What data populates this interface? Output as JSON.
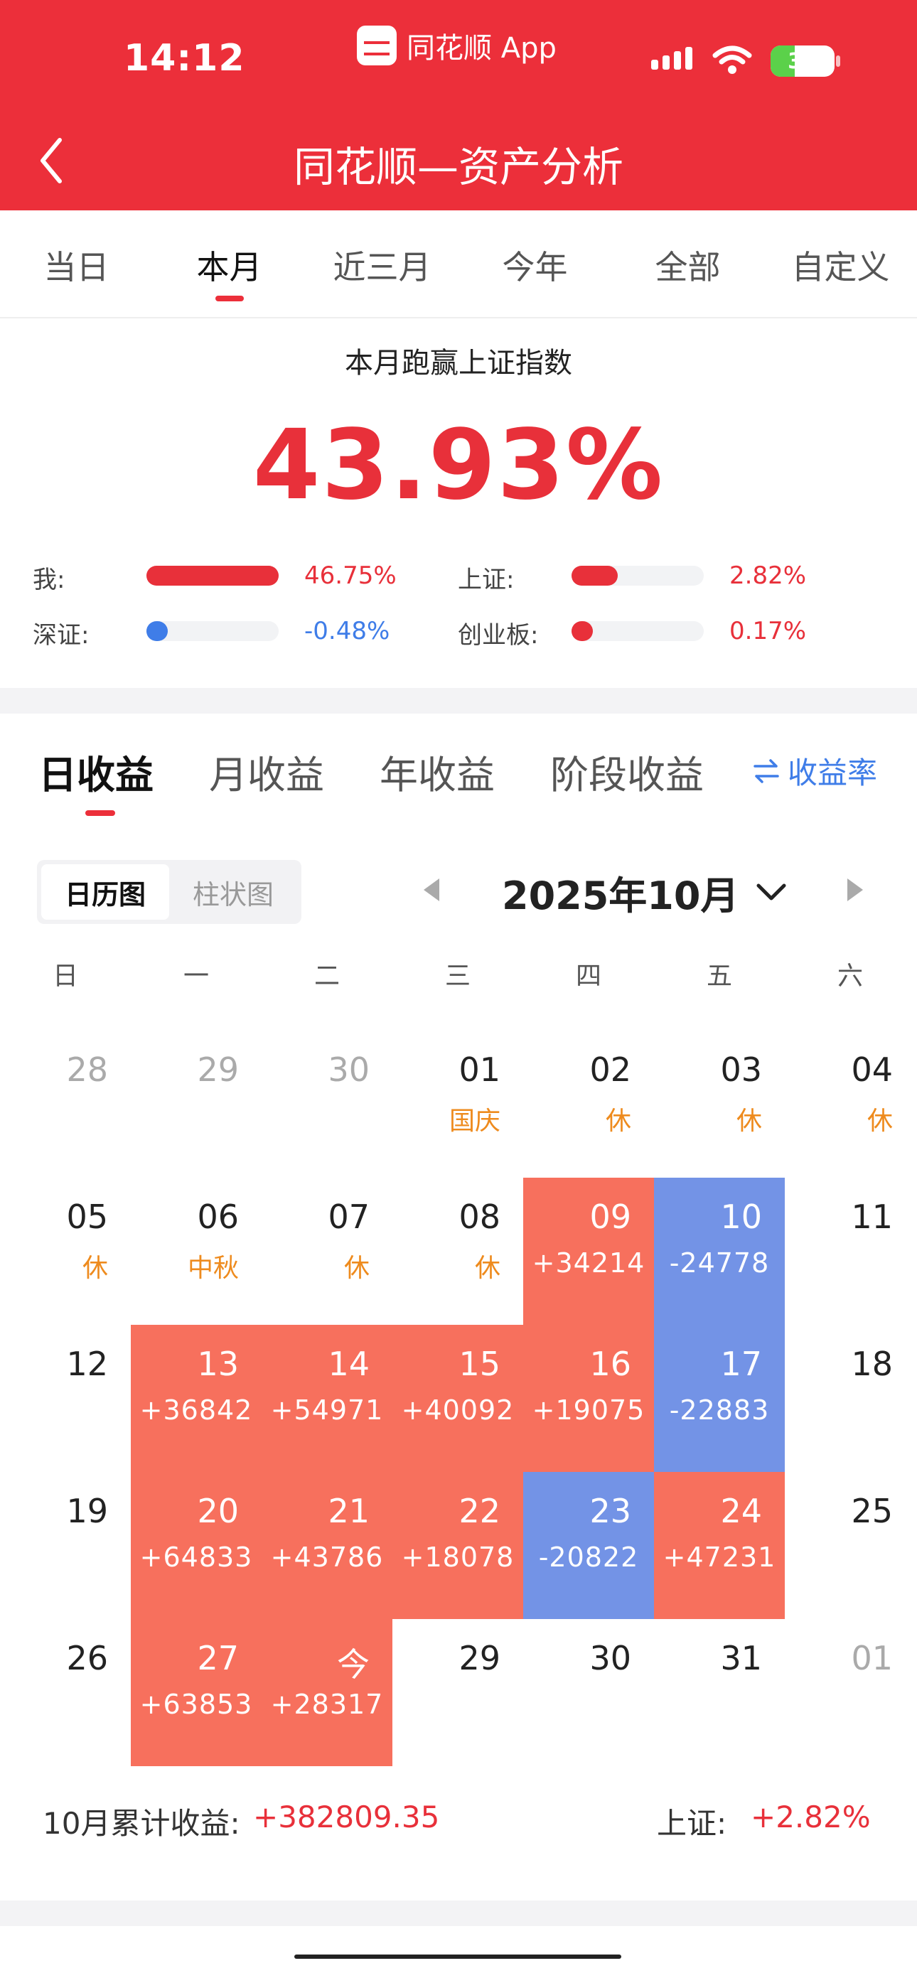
{
  "status_bar": {
    "time": "14:12",
    "app_name": "同花顺 App",
    "battery": "38",
    "battery_level": 0.38
  },
  "nav": {
    "title": "同花顺—资产分析"
  },
  "period_tabs": [
    {
      "label": "当日",
      "active": false
    },
    {
      "label": "本月",
      "active": true
    },
    {
      "label": "近三月",
      "active": false
    },
    {
      "label": "今年",
      "active": false
    },
    {
      "label": "全部",
      "active": false
    },
    {
      "label": "自定义",
      "active": false
    }
  ],
  "summary": {
    "title": "本月跑赢上证指数",
    "value": "43.93%",
    "bars": [
      {
        "label": "我:",
        "value": "46.75%",
        "fill": 1.0,
        "color": "#e8303a"
      },
      {
        "label": "上证:",
        "value": "2.82%",
        "fill": 0.35,
        "color": "#e8303a"
      },
      {
        "label": "深证:",
        "value": "-0.48%",
        "fill": 0.16,
        "color": "#3f7de8"
      },
      {
        "label": "创业板:",
        "value": "0.17%",
        "fill": 0.16,
        "color": "#e8303a"
      }
    ]
  },
  "sub_tabs": [
    {
      "label": "日收益",
      "active": true
    },
    {
      "label": "月收益",
      "active": false
    },
    {
      "label": "年收益",
      "active": false
    },
    {
      "label": "阶段收益",
      "active": false
    }
  ],
  "yield_toggle": "收益率",
  "view_toggle": {
    "calendar": "日历图",
    "bar": "柱状图"
  },
  "month_title": "2025年10月",
  "weekdays": [
    "日",
    "一",
    "二",
    "三",
    "四",
    "五",
    "六"
  ],
  "calendar": [
    [
      {
        "day": "28",
        "muted": true
      },
      {
        "day": "29",
        "muted": true
      },
      {
        "day": "30",
        "muted": true
      },
      {
        "day": "01",
        "sub": "国庆",
        "type": "holiday"
      },
      {
        "day": "02",
        "sub": "休",
        "type": "holiday"
      },
      {
        "day": "03",
        "sub": "休",
        "type": "holiday"
      },
      {
        "day": "04",
        "sub": "休",
        "type": "holiday"
      }
    ],
    [
      {
        "day": "05",
        "sub": "休",
        "type": "holiday"
      },
      {
        "day": "06",
        "sub": "中秋",
        "type": "holiday"
      },
      {
        "day": "07",
        "sub": "休",
        "type": "holiday"
      },
      {
        "day": "08",
        "sub": "休",
        "type": "holiday"
      },
      {
        "day": "09",
        "sub": "+34214",
        "type": "gain"
      },
      {
        "day": "10",
        "sub": "-24778",
        "type": "loss"
      },
      {
        "day": "11"
      }
    ],
    [
      {
        "day": "12"
      },
      {
        "day": "13",
        "sub": "+36842",
        "type": "gain"
      },
      {
        "day": "14",
        "sub": "+54971",
        "type": "gain"
      },
      {
        "day": "15",
        "sub": "+40092",
        "type": "gain"
      },
      {
        "day": "16",
        "sub": "+19075",
        "type": "gain"
      },
      {
        "day": "17",
        "sub": "-22883",
        "type": "loss"
      },
      {
        "day": "18"
      }
    ],
    [
      {
        "day": "19"
      },
      {
        "day": "20",
        "sub": "+64833",
        "type": "gain"
      },
      {
        "day": "21",
        "sub": "+43786",
        "type": "gain"
      },
      {
        "day": "22",
        "sub": "+18078",
        "type": "gain"
      },
      {
        "day": "23",
        "sub": "-20822",
        "type": "loss"
      },
      {
        "day": "24",
        "sub": "+47231",
        "type": "gain"
      },
      {
        "day": "25"
      }
    ],
    [
      {
        "day": "26"
      },
      {
        "day": "27",
        "sub": "+63853",
        "type": "gain"
      },
      {
        "day": "今",
        "sub": "+28317",
        "type": "gain"
      },
      {
        "day": "29"
      },
      {
        "day": "30"
      },
      {
        "day": "31"
      },
      {
        "day": "01",
        "muted": true
      }
    ]
  ],
  "totals": {
    "label": "10月累计收益:",
    "value": "+382809.35",
    "index_label": "上证:",
    "index_value": "+2.82%"
  },
  "colors": {
    "brand_red": "#ec2f3a",
    "gain": "#f7705d",
    "loss": "#7393e6",
    "holiday": "#ee8b1e",
    "link_blue": "#3f7de8"
  }
}
